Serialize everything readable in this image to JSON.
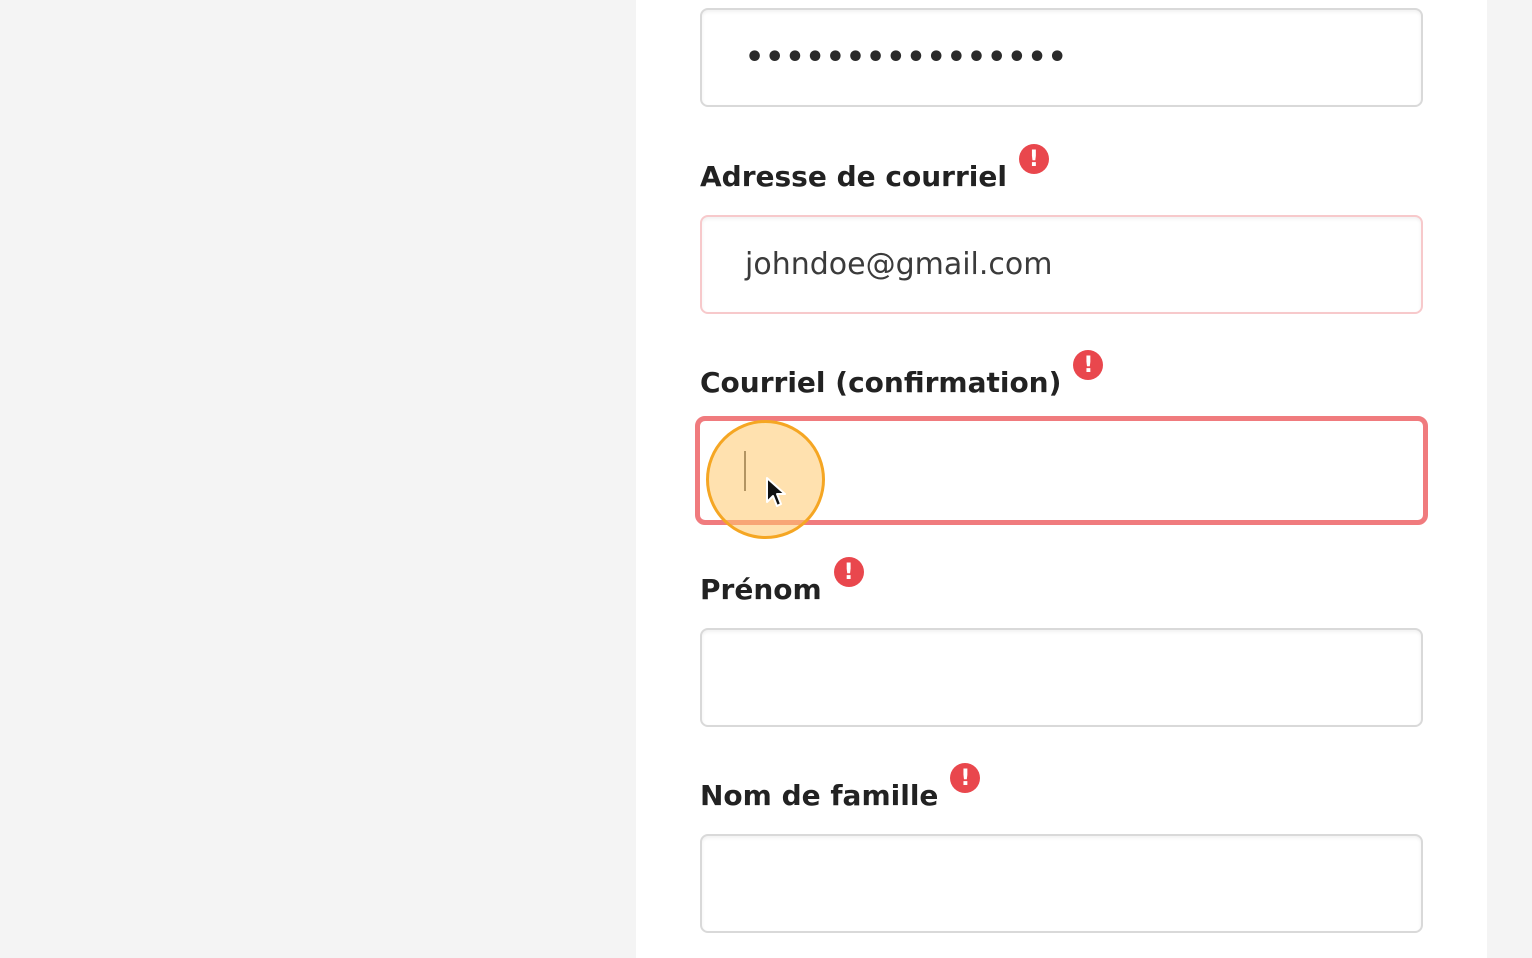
{
  "form": {
    "password_field": {
      "value": "••••••••••••••••"
    },
    "email": {
      "label": "Adresse de courriel",
      "value": "johndoe@gmail.com",
      "required_icon": "exclamation-icon"
    },
    "email_confirm": {
      "label": "Courriel (confirmation)",
      "value": "",
      "required_icon": "exclamation-icon"
    },
    "first_name": {
      "label": "Prénom",
      "value": "",
      "required_icon": "exclamation-icon"
    },
    "last_name": {
      "label": "Nom de famille",
      "value": "",
      "required_icon": "exclamation-icon"
    }
  },
  "icons": {
    "required_glyph": "!"
  },
  "colors": {
    "error": "#e9474d",
    "focus_border": "#f07b7e",
    "highlight": "#f5a623",
    "page_bg": "#f4f4f4",
    "panel_bg": "#ffffff"
  }
}
